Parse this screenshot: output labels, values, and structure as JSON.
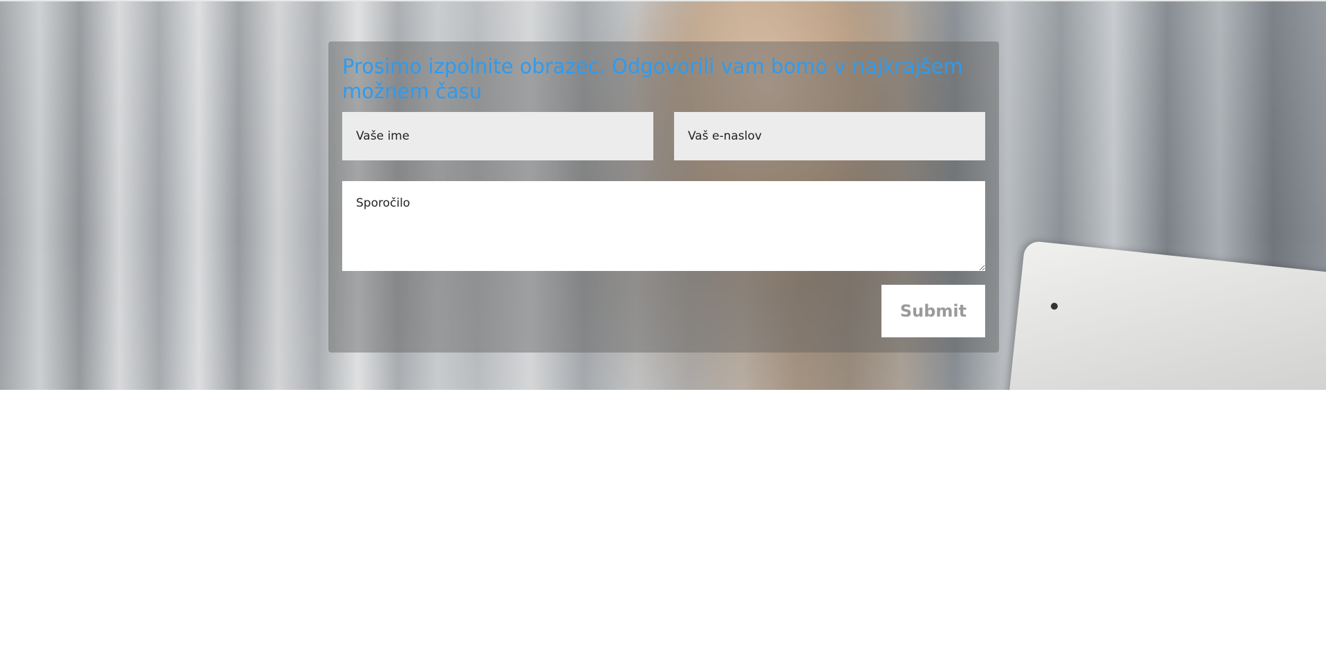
{
  "contact_form": {
    "title": "Prosimo izpolnite obrazec. Odgovorili vam bomo v najkrajšem možnem času",
    "name_placeholder": "Vaše ime",
    "email_placeholder": "Vaš e-naslov",
    "message_placeholder": "Sporočilo",
    "submit_label": "Submit"
  },
  "colors": {
    "title_accent": "#2e9bf0"
  }
}
